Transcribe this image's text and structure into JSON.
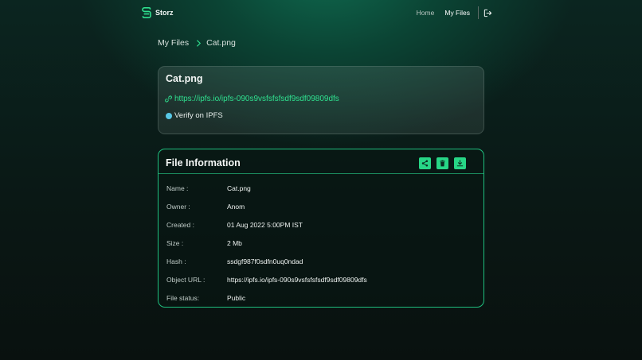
{
  "nav": {
    "brand": "Storz",
    "links": [
      {
        "label": "Home",
        "active": false
      },
      {
        "label": "My Files",
        "active": true
      }
    ],
    "logout_icon": "logout-icon"
  },
  "breadcrumb": {
    "root": "My Files",
    "current": "Cat.png"
  },
  "file_card": {
    "title": "Cat.png",
    "link": "https://ipfs.io/ipfs-090s9vsfsfsfsdf9sdf09809dfs",
    "verify_label": "Verify on IPFS"
  },
  "info_card": {
    "title": "File Information",
    "actions": [
      "share-icon",
      "delete-icon",
      "download-icon"
    ],
    "rows": [
      {
        "label": "Name :",
        "value": "Cat.png"
      },
      {
        "label": "Owner :",
        "value": "Anom"
      },
      {
        "label": "Created :",
        "value": "01 Aug 2022 5:00PM IST"
      },
      {
        "label": "Size :",
        "value": "2 Mb"
      },
      {
        "label": "Hash :",
        "value": "ssdgf987f0sdfn0uq0ndad"
      },
      {
        "label": "Object URL :",
        "value": "https://ipfs.io/ipfs-090s9vsfsfsfsdf9sdf09809dfs"
      },
      {
        "label": "File status:",
        "value": "Public"
      }
    ]
  },
  "colors": {
    "accent": "#27d686",
    "link": "#2fe08f",
    "verify_dot": "#58c8e6"
  }
}
